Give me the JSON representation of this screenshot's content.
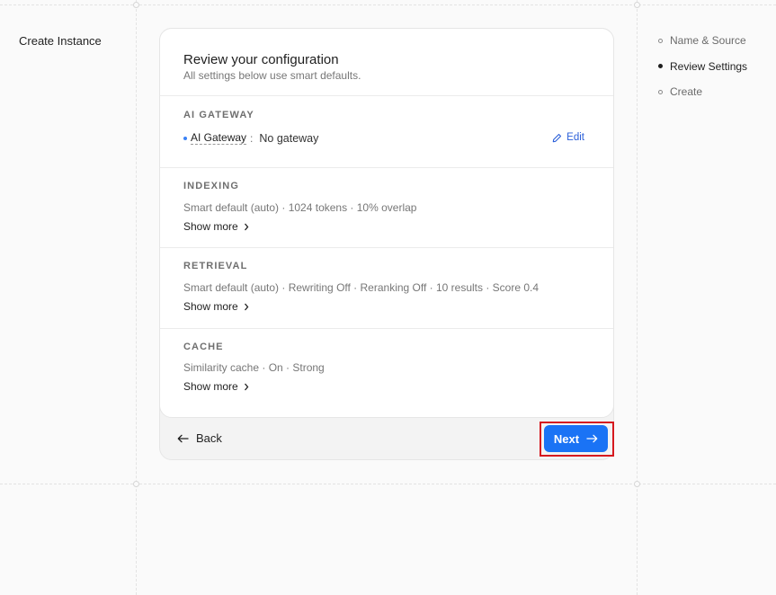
{
  "page": {
    "title": "Create Instance"
  },
  "steps": [
    {
      "label": "Name & Source",
      "active": false
    },
    {
      "label": "Review Settings",
      "active": true
    },
    {
      "label": "Create",
      "active": false
    }
  ],
  "review": {
    "title": "Review your configuration",
    "subtitle": "All settings below use smart defaults.",
    "sections": {
      "gateway": {
        "label": "AI GATEWAY",
        "item_name": "AI Gateway",
        "colon": ":",
        "value": "No gateway",
        "edit_label": "Edit"
      },
      "indexing": {
        "label": "INDEXING",
        "summary": "Smart default (auto) · 1024 tokens · 10% overlap",
        "show_more": "Show more"
      },
      "retrieval": {
        "label": "RETRIEVAL",
        "summary": "Smart default (auto) · Rewriting Off · Reranking Off · 10 results · Score 0.4",
        "show_more": "Show more"
      },
      "cache": {
        "label": "CACHE",
        "summary": "Similarity cache · On · Strong",
        "show_more": "Show more"
      }
    }
  },
  "footer": {
    "back_label": "Back",
    "next_label": "Next"
  },
  "colors": {
    "accent": "#1a73f5",
    "highlight": "#d6191f",
    "gateway_dot": "#3b82f6"
  },
  "icons": [
    "pencil-icon",
    "chevron-right-icon",
    "arrow-left-icon",
    "arrow-right-icon"
  ]
}
